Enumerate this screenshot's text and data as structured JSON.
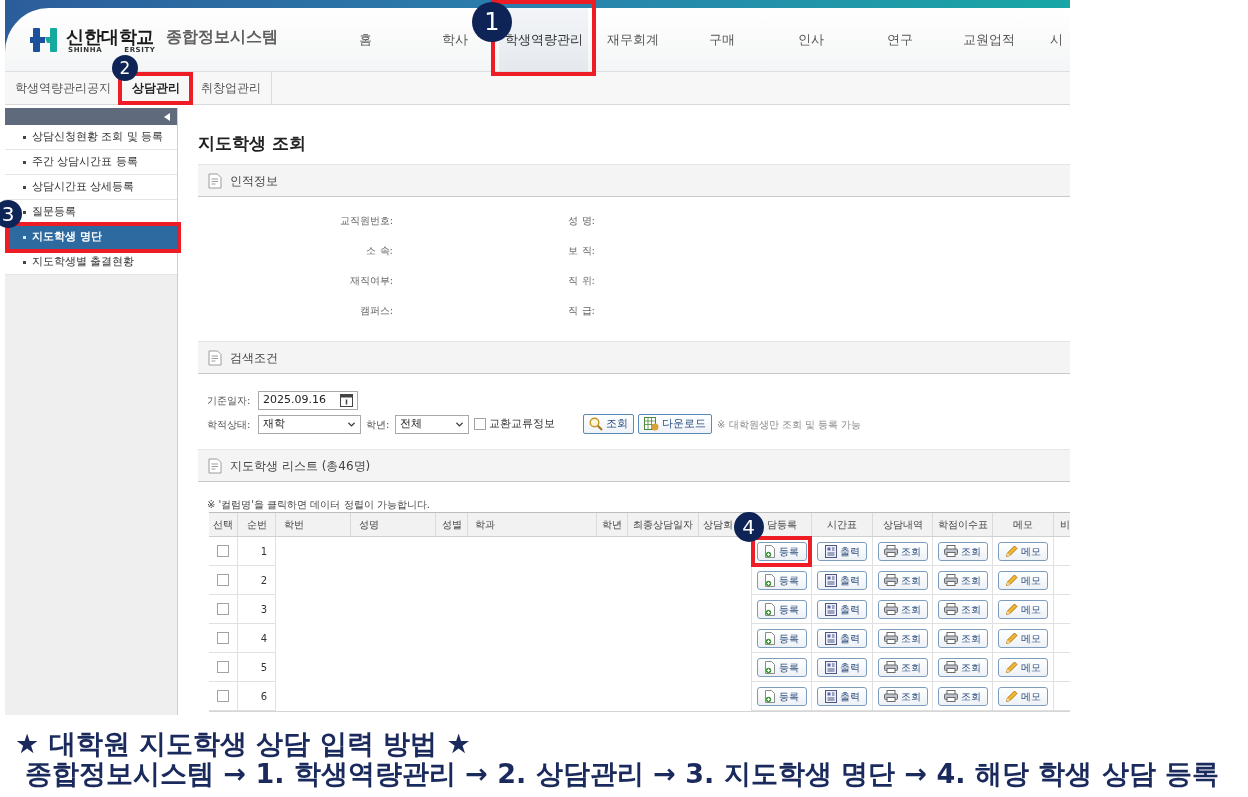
{
  "header": {
    "university_name": "신한대학교",
    "university_subtitle": [
      "SHINHA",
      "ERSITY"
    ],
    "system_name": "종합정보시스템"
  },
  "nav": [
    {
      "label": "홈",
      "selected": false
    },
    {
      "label": "학사",
      "selected": false
    },
    {
      "label": "학생역량관리",
      "selected": true,
      "callout": "1"
    },
    {
      "label": "재무회계",
      "selected": false
    },
    {
      "label": "구매",
      "selected": false
    },
    {
      "label": "인사",
      "selected": false
    },
    {
      "label": "연구",
      "selected": false
    },
    {
      "label": "교원업적",
      "selected": false
    },
    {
      "label": "시",
      "selected": false
    }
  ],
  "subnav": [
    {
      "label": "학생역량관리공지",
      "selected": false
    },
    {
      "label": "상담관리",
      "selected": true,
      "callout": "2"
    },
    {
      "label": "취창업관리",
      "selected": false
    }
  ],
  "sidebar": {
    "items": [
      {
        "label": "상담신청현황 조회 및 등록",
        "selected": false
      },
      {
        "label": "주간 상담시간표 등록",
        "selected": false
      },
      {
        "label": "상담시간표 상세등록",
        "selected": false
      },
      {
        "label": "질문등록",
        "selected": false
      },
      {
        "label": "지도학생 명단",
        "selected": true,
        "callout": "3"
      },
      {
        "label": "지도학생별 출결현황",
        "selected": false
      }
    ]
  },
  "page_title": "지도학생 조회",
  "personal_info": {
    "title": "인적정보",
    "fields": [
      {
        "label": "교직원번호:"
      },
      {
        "label": "성 명:"
      },
      {
        "label": "소 속:"
      },
      {
        "label": "보 직:"
      },
      {
        "label": "재직여부:"
      },
      {
        "label": "직 위:"
      },
      {
        "label": "캠퍼스:"
      },
      {
        "label": "직 급:"
      }
    ]
  },
  "search": {
    "title": "검색조건",
    "date": {
      "label": "기준일자:",
      "value": "2025.09.16"
    },
    "status": {
      "label": "학적상태:",
      "value": "재학"
    },
    "grade": {
      "label": "학년:",
      "value": "전체"
    },
    "exchange": {
      "label": "교환교류정보",
      "checked": false
    },
    "buttons": [
      {
        "kind": "search",
        "label": "조회"
      },
      {
        "kind": "download",
        "label": "다운로드"
      }
    ],
    "note": "※ 대학원생만 조회 및 등록 가능"
  },
  "student_list": {
    "title": "지도학생 리스트 (총46명)",
    "note": "※ '컬럼명'을 클릭하면 데이터 정렬이 가능합니다.",
    "columns": [
      "선택",
      "순번",
      "학번",
      "성명",
      "성별",
      "학과",
      "학년",
      "최종상담일자",
      "상담회",
      "담등록",
      "시간표",
      "상담내역",
      "학점이수표",
      "메모",
      "비"
    ],
    "rows": [
      {
        "number": "1",
        "selected": false,
        "actions": [
          {
            "kind": "register",
            "label": "등록",
            "callout": "4"
          },
          {
            "kind": "timetable",
            "label": "출력"
          },
          {
            "kind": "history",
            "label": "조회"
          },
          {
            "kind": "credits",
            "label": "조회"
          },
          {
            "kind": "memo",
            "label": "메모"
          }
        ]
      },
      {
        "number": "2",
        "selected": false,
        "actions": [
          {
            "kind": "register",
            "label": "등록"
          },
          {
            "kind": "timetable",
            "label": "출력"
          },
          {
            "kind": "history",
            "label": "조회"
          },
          {
            "kind": "credits",
            "label": "조회"
          },
          {
            "kind": "memo",
            "label": "메모"
          }
        ]
      },
      {
        "number": "3",
        "selected": false,
        "actions": [
          {
            "kind": "register",
            "label": "등록"
          },
          {
            "kind": "timetable",
            "label": "출력"
          },
          {
            "kind": "history",
            "label": "조회"
          },
          {
            "kind": "credits",
            "label": "조회"
          },
          {
            "kind": "memo",
            "label": "메모"
          }
        ]
      },
      {
        "number": "4",
        "selected": false,
        "actions": [
          {
            "kind": "register",
            "label": "등록"
          },
          {
            "kind": "timetable",
            "label": "출력"
          },
          {
            "kind": "history",
            "label": "조회"
          },
          {
            "kind": "credits",
            "label": "조회"
          },
          {
            "kind": "memo",
            "label": "메모"
          }
        ]
      },
      {
        "number": "5",
        "selected": false,
        "actions": [
          {
            "kind": "register",
            "label": "등록"
          },
          {
            "kind": "timetable",
            "label": "출력"
          },
          {
            "kind": "history",
            "label": "조회"
          },
          {
            "kind": "credits",
            "label": "조회"
          },
          {
            "kind": "memo",
            "label": "메모"
          }
        ]
      },
      {
        "number": "6",
        "selected": false,
        "actions": [
          {
            "kind": "register",
            "label": "등록"
          },
          {
            "kind": "timetable",
            "label": "출력"
          },
          {
            "kind": "history",
            "label": "조회"
          },
          {
            "kind": "credits",
            "label": "조회"
          },
          {
            "kind": "memo",
            "label": "메모"
          }
        ]
      }
    ]
  },
  "guide": {
    "title": "★ 대학원 지도학생 상담 입력 방법 ★",
    "steps": "종합정보시스템 → 1. 학생역량관리 → 2. 상담관리 → 3. 지도학생 명단 → 4. 해당 학생 상담 등록"
  }
}
